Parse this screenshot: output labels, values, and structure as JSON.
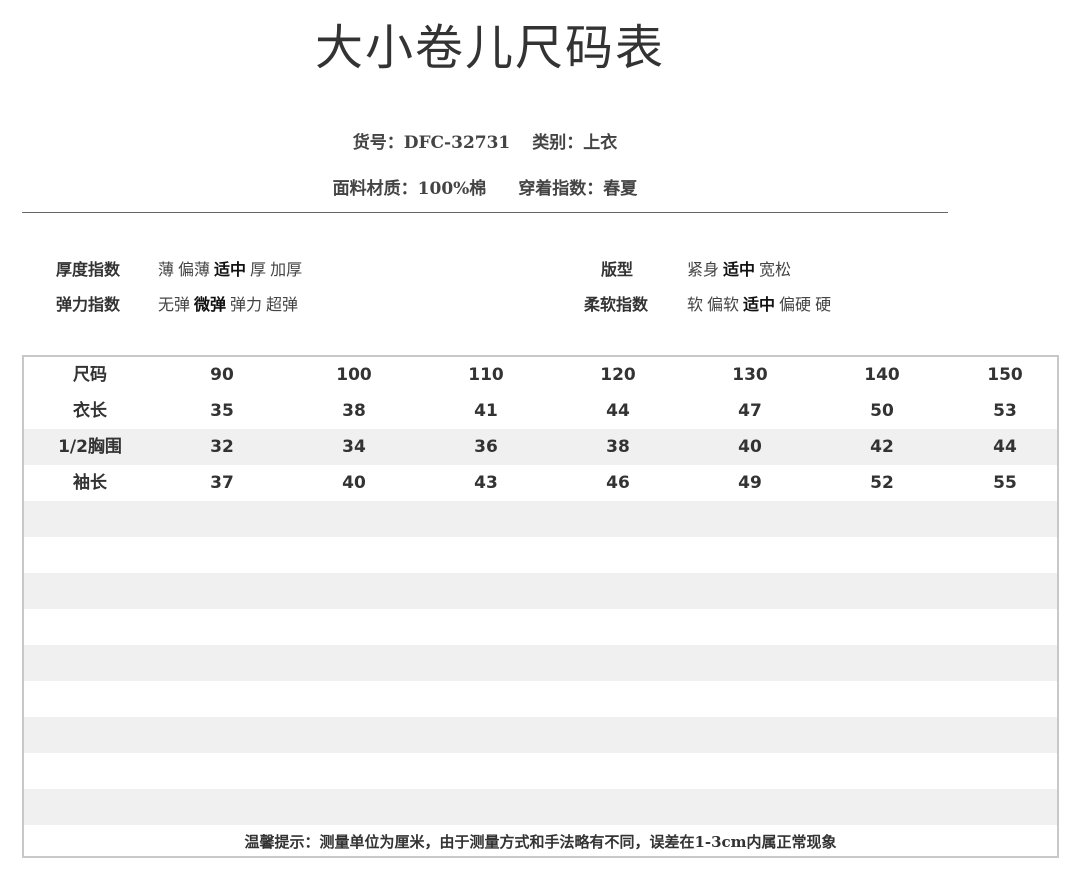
{
  "title": "大小卷儿尺码表",
  "meta": {
    "item_no_label": "货号：DFC-32731",
    "category_label": "类别：上衣",
    "fabric_label": "面料材质：100%棉",
    "season_label": "穿着指数：春夏"
  },
  "attributes": {
    "thickness": {
      "label": "厚度指数",
      "options": [
        "薄",
        "偏薄",
        "适中",
        "厚",
        "加厚"
      ],
      "selected": "适中"
    },
    "elasticity": {
      "label": "弹力指数",
      "options": [
        "无弹",
        "微弹",
        "弹力",
        "超弹"
      ],
      "selected": "微弹"
    },
    "fit": {
      "label": "版型",
      "options": [
        "紧身",
        "适中",
        "宽松"
      ],
      "selected": "适中"
    },
    "softness": {
      "label": "柔软指数",
      "options": [
        "软",
        "偏软",
        "适中",
        "偏硬",
        "硬"
      ],
      "selected": "适中"
    }
  },
  "size_table": {
    "headers": [
      "尺码",
      "90",
      "100",
      "110",
      "120",
      "130",
      "140",
      "150"
    ],
    "rows": [
      [
        "衣长",
        "35",
        "38",
        "41",
        "44",
        "47",
        "50",
        "53"
      ],
      [
        "1/2胸围",
        "32",
        "34",
        "36",
        "38",
        "40",
        "42",
        "44"
      ],
      [
        "袖长",
        "37",
        "40",
        "43",
        "46",
        "49",
        "52",
        "55"
      ]
    ],
    "empty_rows": 9
  },
  "footer_note": "温馨提示：测量单位为厘米，由于测量方式和手法略有不同，误差在1-3cm内属正常现象"
}
